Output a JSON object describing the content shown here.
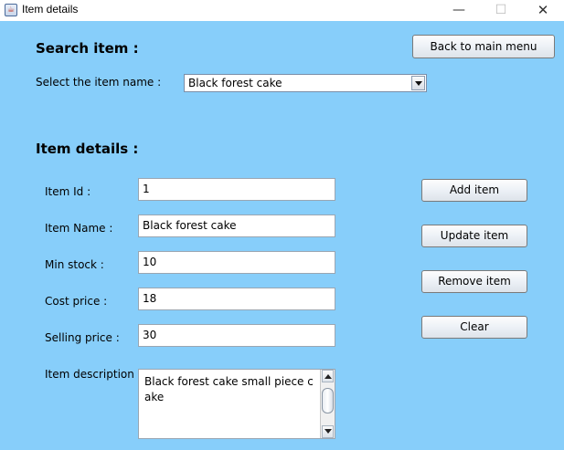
{
  "window": {
    "title": "Item details",
    "icon": "java-app-icon",
    "controls": {
      "minimize": "—",
      "maximize": "☐",
      "close": "✕"
    }
  },
  "colors": {
    "background": "#87cefa",
    "field_bg": "#ffffff"
  },
  "search": {
    "heading": "Search item :",
    "select_label": "Select the item name :",
    "selected_item": "Black forest cake",
    "back_button": "Back to main menu"
  },
  "details": {
    "heading": "Item details :",
    "fields": {
      "item_id": {
        "label": "Item Id :",
        "value": "1"
      },
      "item_name": {
        "label": "Item Name :",
        "value": "Black forest cake"
      },
      "min_stock": {
        "label": "Min stock :",
        "value": "10"
      },
      "cost_price": {
        "label": "Cost price :",
        "value": "18"
      },
      "selling_price": {
        "label": "Selling price :",
        "value": "30"
      },
      "description": {
        "label": "Item description :",
        "value": "Black forest cake small piece cake"
      }
    }
  },
  "actions": {
    "add": "Add item",
    "update": "Update item",
    "remove": "Remove item",
    "clear": "Clear"
  }
}
